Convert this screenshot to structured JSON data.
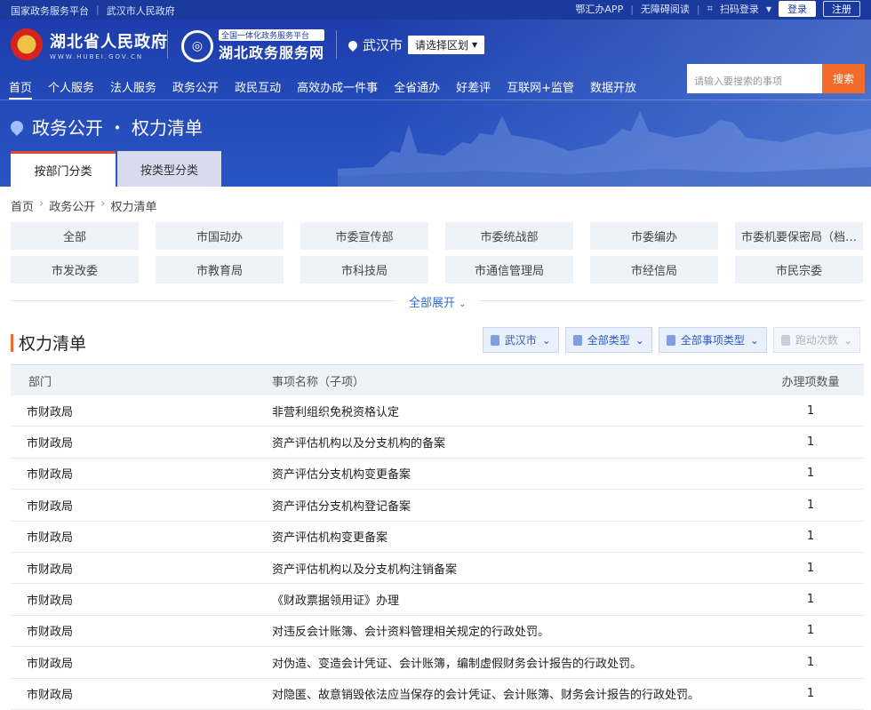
{
  "topbar": {
    "left": [
      "国家政务服务平台",
      "武汉市人民政府"
    ],
    "right": [
      "鄂汇办APP",
      "无障碍阅读",
      "扫码登录"
    ],
    "login": "登录",
    "register": "注册"
  },
  "logo": {
    "gov_name": "湖北省人民政府",
    "gov_url": "WWW.HUBEI.GOV.CN",
    "platform_tag": "全国一体化政务服务平台",
    "platform_name": "湖北政务服务网"
  },
  "location": {
    "city": "武汉市",
    "district_placeholder": "请选择区划"
  },
  "nav": [
    "首页",
    "个人服务",
    "法人服务",
    "政务公开",
    "政民互动",
    "高效办成一件事",
    "全省通办",
    "好差评",
    "互联网+监管",
    "数据开放"
  ],
  "search": {
    "placeholder": "请输入要搜索的事项",
    "button": "搜索"
  },
  "page_title": {
    "part1": "政务公开",
    "dot": "・",
    "part2": "权力清单"
  },
  "tabs": [
    "按部门分类",
    "按类型分类"
  ],
  "breadcrumb": [
    "首页",
    "政务公开",
    "权力清单"
  ],
  "departments": [
    "全部",
    "市国动办",
    "市委宣传部",
    "市委统战部",
    "市委编办",
    "市委机要保密局（档…",
    "市发改委",
    "市教育局",
    "市科技局",
    "市通信管理局",
    "市经信局",
    "市民宗委"
  ],
  "expand_label": "全部展开",
  "section_title": "权力清单",
  "filters": [
    "武汉市",
    "全部类型",
    "全部事项类型",
    "跑动次数"
  ],
  "table": {
    "headers": [
      "部门",
      "事项名称（子项）",
      "办理项数量"
    ],
    "rows": [
      [
        "市财政局",
        "非营利组织免税资格认定",
        "1"
      ],
      [
        "市财政局",
        "资产评估机构以及分支机构的备案",
        "1"
      ],
      [
        "市财政局",
        "资产评估分支机构变更备案",
        "1"
      ],
      [
        "市财政局",
        "资产评估分支机构登记备案",
        "1"
      ],
      [
        "市财政局",
        "资产评估机构变更备案",
        "1"
      ],
      [
        "市财政局",
        "资产评估机构以及分支机构注销备案",
        "1"
      ],
      [
        "市财政局",
        "《财政票据领用证》办理",
        "1"
      ],
      [
        "市财政局",
        "对违反会计账簿、会计资料管理相关规定的行政处罚。",
        "1"
      ],
      [
        "市财政局",
        "对伪造、变造会计凭证、会计账簿，编制虚假财务会计报告的行政处罚。",
        "1"
      ],
      [
        "市财政局",
        "对隐匿、故意销毁依法应当保存的会计凭证、会计账簿、财务会计报告的行政处罚。",
        "1"
      ]
    ]
  }
}
